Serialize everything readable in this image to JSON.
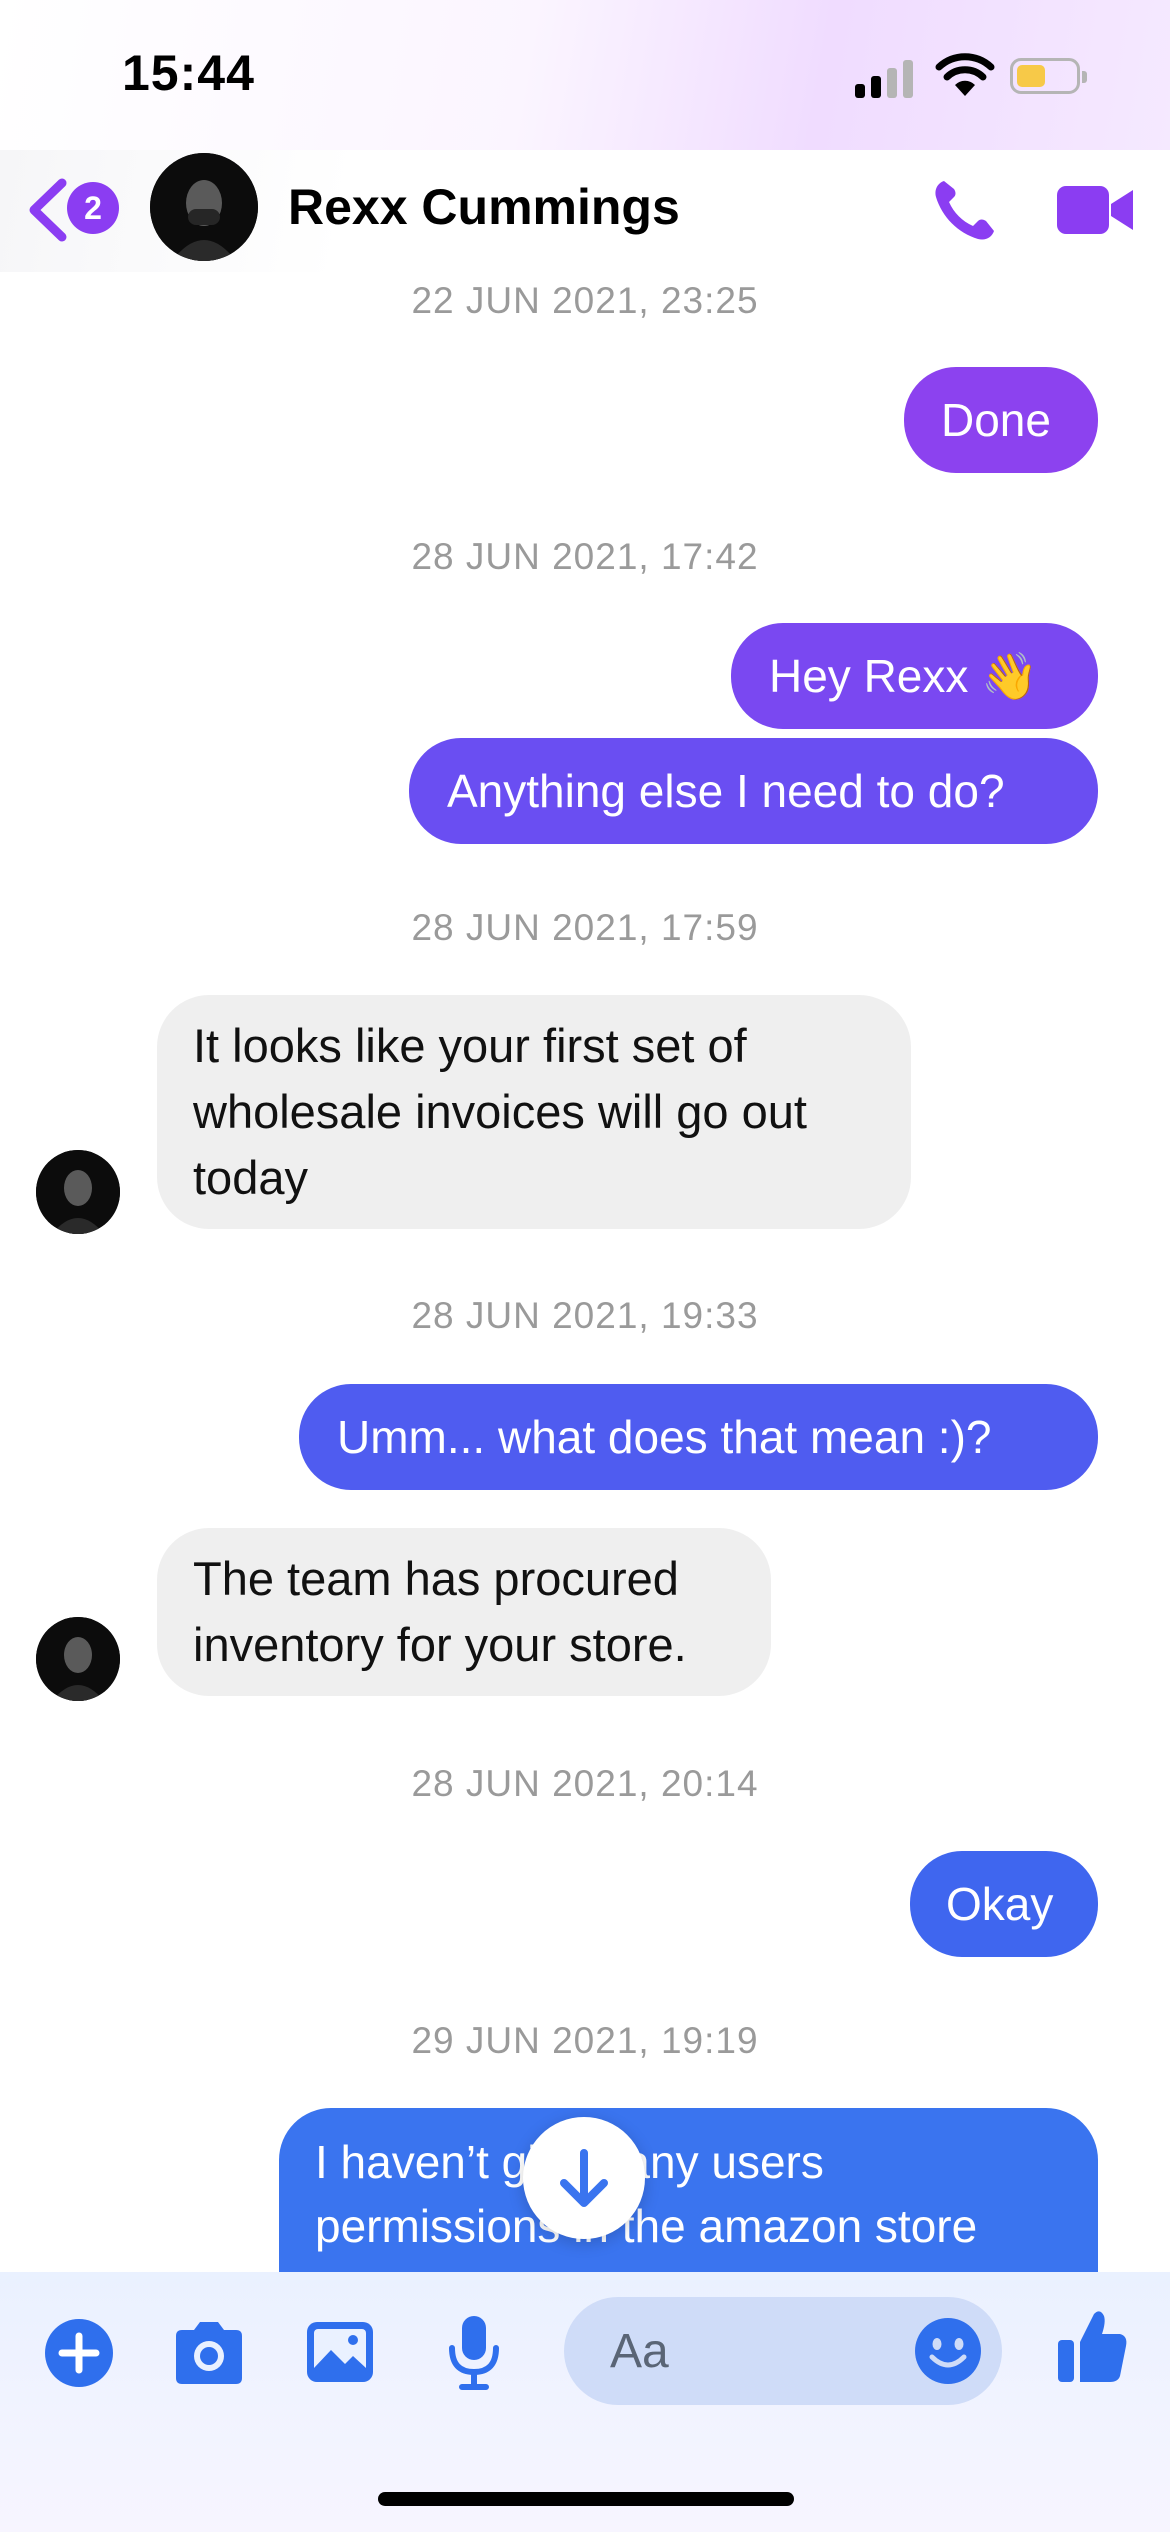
{
  "status_bar": {
    "time": "15:44"
  },
  "header": {
    "back_badge": "2",
    "contact_name": "Rexx Cummings"
  },
  "thread": {
    "ts1": "22 JUN 2021, 23:25",
    "m1": "Done",
    "ts2": "28 JUN 2021, 17:42",
    "m2": "Hey Rexx 👋",
    "m3": "Anything else I need to do?",
    "ts3": "28 JUN 2021, 17:59",
    "m4": "It looks like your first set of wholesale invoices will go out today",
    "ts4": "28 JUN 2021, 19:33",
    "m5": "Umm... what does that mean :)?",
    "m6": "The team has procured inventory for your store.",
    "ts5": "28 JUN 2021, 20:14",
    "m7": "Okay",
    "ts6": "29 JUN 2021, 19:19",
    "m8_line1": "I haven’t given any users",
    "m8_line2": "permissions in the amazon store"
  },
  "composer": {
    "placeholder": "Aa"
  },
  "colors": {
    "accent_purple": "#8b3df2",
    "accent_blue": "#3b6ff0",
    "bubble_incoming": "#efefef"
  }
}
